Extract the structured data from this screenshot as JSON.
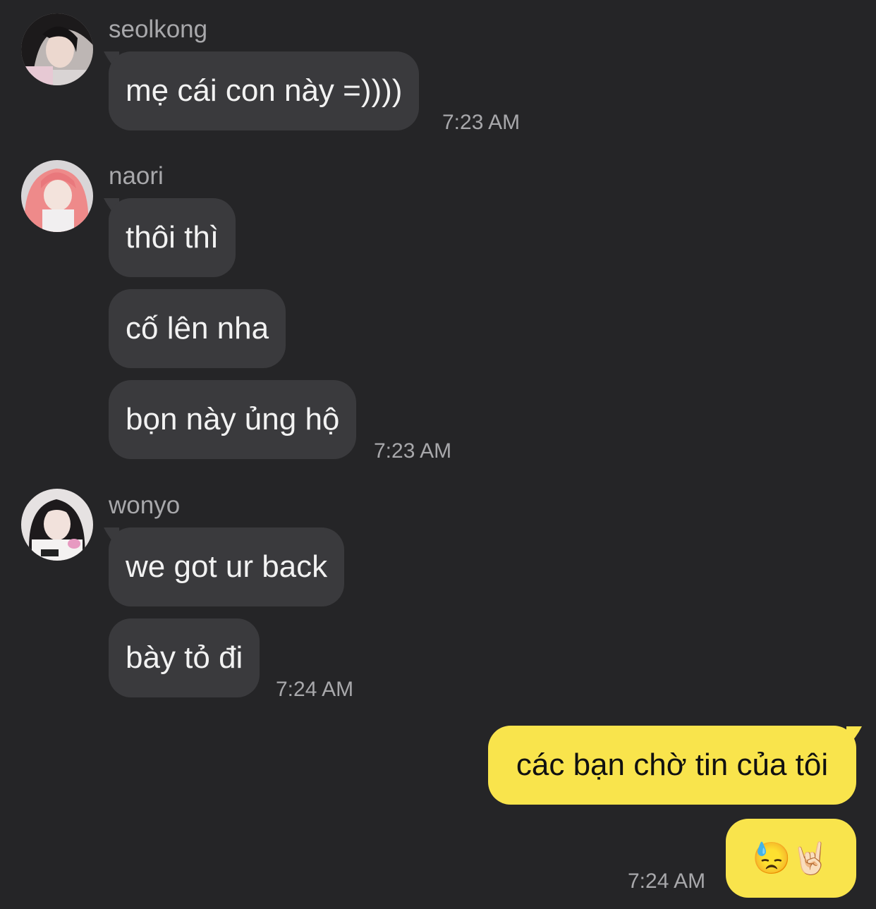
{
  "colors": {
    "background": "#252527",
    "incoming_bubble": "#3a3a3d",
    "outgoing_bubble": "#f9e44c",
    "meta_text": "#a8a8ab"
  },
  "groups": [
    {
      "sender": "seolkong",
      "avatar": "avatar-seolkong",
      "messages": [
        "mẹ cái con này =))))"
      ],
      "time": "7:23 AM"
    },
    {
      "sender": "naori",
      "avatar": "avatar-naori",
      "messages": [
        "thôi thì",
        "cố lên nha",
        "bọn này ủng hộ"
      ],
      "time": "7:23 AM"
    },
    {
      "sender": "wonyo",
      "avatar": "avatar-wonyo",
      "messages": [
        "we got ur back",
        "bày tỏ đi"
      ],
      "time": "7:24 AM"
    }
  ],
  "outgoing": {
    "messages": [
      "các bạn chờ tin của tôi",
      "😓🤘🏻"
    ],
    "time": "7:24 AM"
  }
}
